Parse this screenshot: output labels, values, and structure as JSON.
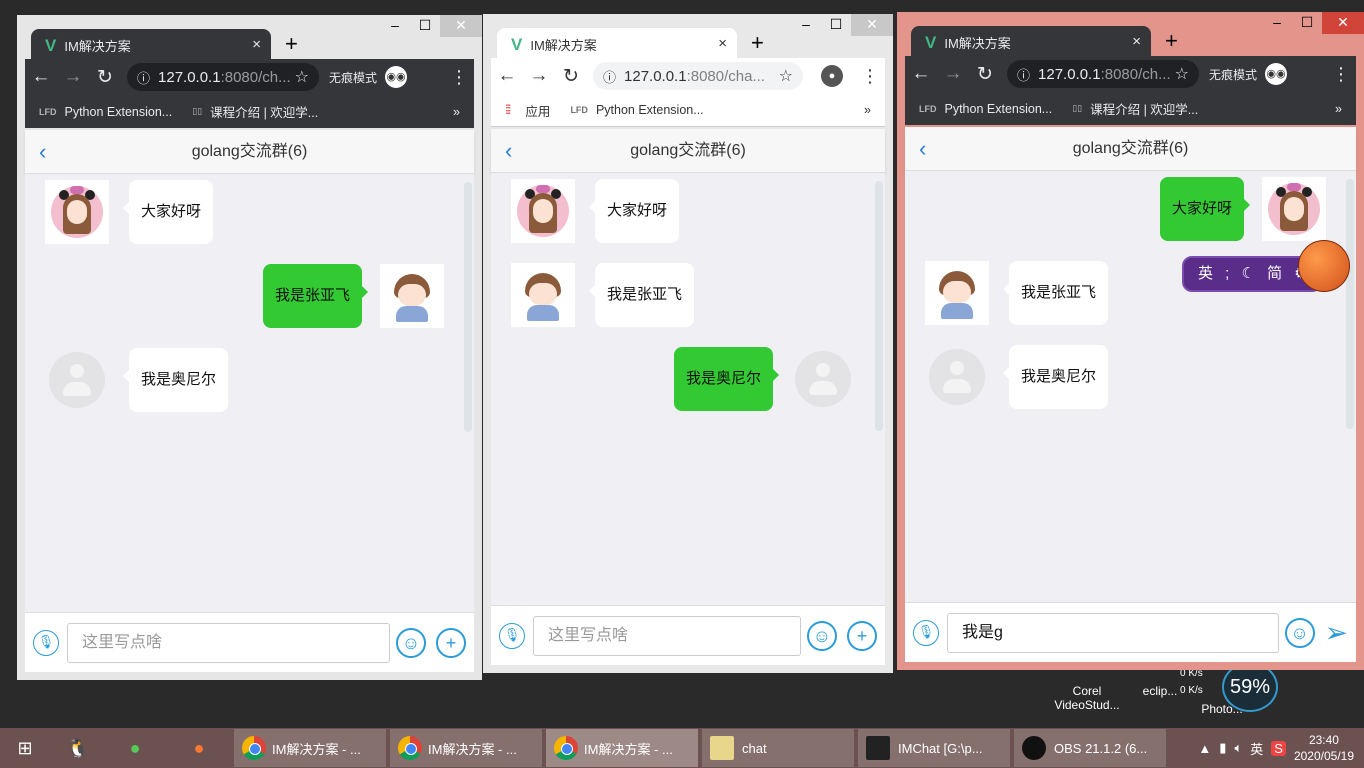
{
  "desktop": {
    "icons": [
      {
        "label": "Corel\nVideoStud..."
      },
      {
        "label": "eclip..."
      },
      {
        "label": "Photo..."
      }
    ],
    "net_up": "0 K/s",
    "net_down": "0 K/s",
    "percent": "59%"
  },
  "windows": [
    {
      "theme": "dark",
      "tab_title": "IM解决方案",
      "url_host": "127.0.0.1",
      "url_rest": ":8080/ch...",
      "incognito_label": "无痕模式",
      "bookmarks": [
        "Python Extension...",
        "课程介绍 | 欢迎学..."
      ],
      "bookmarks_more": "»",
      "chat_title": "golang交流群(6)",
      "messages": [
        {
          "side": "left",
          "avatar": "girl",
          "text": "大家好呀"
        },
        {
          "side": "right",
          "avatar": "boy",
          "text": "我是张亚飞"
        },
        {
          "side": "left",
          "avatar": "default",
          "text": "我是奥尼尔"
        }
      ],
      "input_placeholder": "这里写点啥",
      "input_value": "",
      "action": "plus"
    },
    {
      "theme": "light",
      "tab_title": "IM解决方案",
      "url_host": "127.0.0.1",
      "url_rest": ":8080/cha...",
      "incognito_label": "",
      "bookmarks": [
        "应用",
        "Python Extension..."
      ],
      "bookmarks_more": "»",
      "chat_title": "golang交流群(6)",
      "messages": [
        {
          "side": "left",
          "avatar": "girl",
          "text": "大家好呀"
        },
        {
          "side": "left",
          "avatar": "boy",
          "text": "我是张亚飞"
        },
        {
          "side": "right",
          "avatar": "default",
          "text": "我是奥尼尔"
        }
      ],
      "input_placeholder": "这里写点啥",
      "input_value": "",
      "action": "plus"
    },
    {
      "theme": "dark",
      "tab_title": "IM解决方案",
      "url_host": "127.0.0.1",
      "url_rest": ":8080/ch...",
      "incognito_label": "无痕模式",
      "bookmarks": [
        "Python Extension...",
        "课程介绍 | 欢迎学..."
      ],
      "bookmarks_more": "»",
      "chat_title": "golang交流群(6)",
      "messages": [
        {
          "side": "right",
          "avatar": "girl",
          "text": "大家好呀"
        },
        {
          "side": "left",
          "avatar": "boy",
          "text": "我是张亚飞"
        },
        {
          "side": "left",
          "avatar": "default",
          "text": "我是奥尼尔"
        }
      ],
      "input_placeholder": "这里写点啥",
      "input_value": "我是g",
      "action": "send"
    }
  ],
  "ime": {
    "text": "英 ; ☾ 简 ⚙"
  },
  "taskbar": {
    "tasks": [
      {
        "label": "IM解决方案 - ...",
        "icon": "chrome"
      },
      {
        "label": "IM解决方案 - ...",
        "icon": "chrome"
      },
      {
        "label": "IM解决方案 - ...",
        "icon": "chrome",
        "active": true
      },
      {
        "label": "chat",
        "icon": "folder"
      },
      {
        "label": "IMChat [G:\\p...",
        "icon": "goland"
      },
      {
        "label": "OBS 21.1.2 (6...",
        "icon": "obs"
      }
    ],
    "tray_lang": "英",
    "time": "23:40",
    "date": "2020/05/19"
  }
}
